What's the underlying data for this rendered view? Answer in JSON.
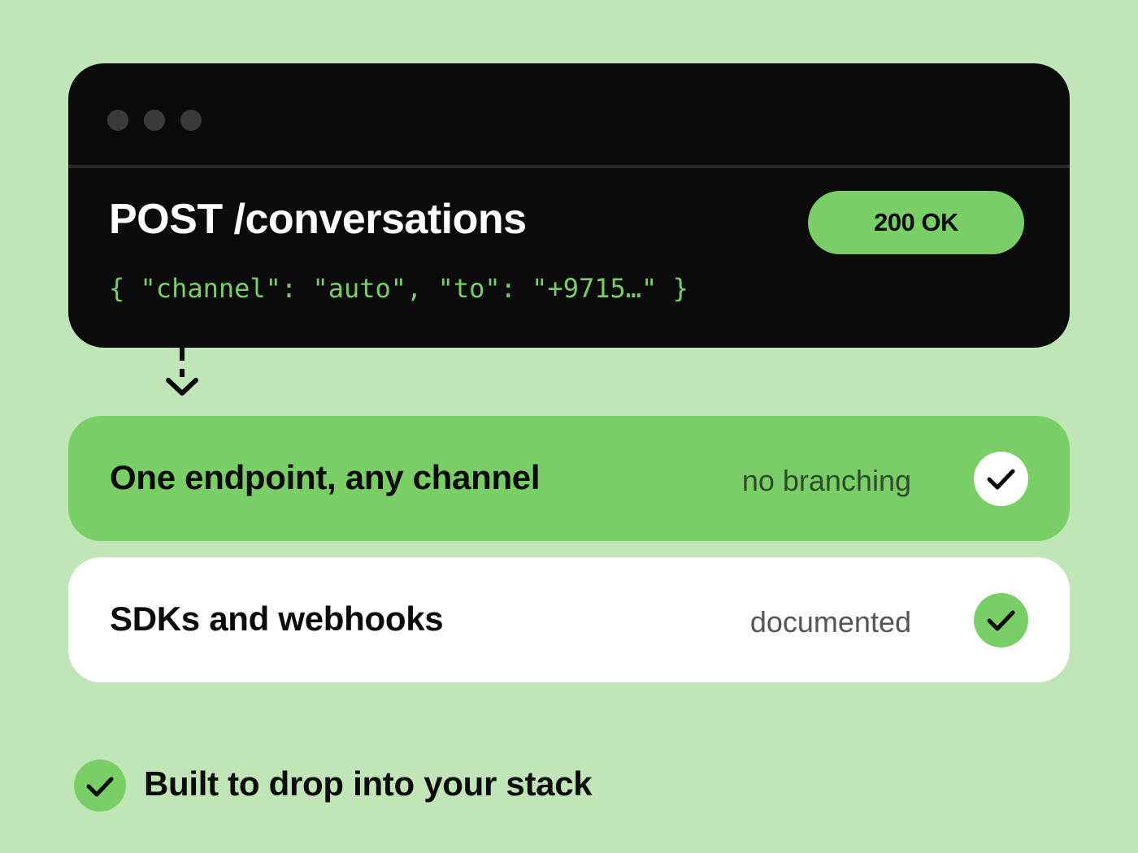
{
  "request": {
    "method_path": "POST /conversations",
    "status": "200 OK",
    "payload": "{ \"channel\": \"auto\", \"to\": \"+9715…\" }"
  },
  "features": [
    {
      "title": "One endpoint, any channel",
      "tag": "no branching",
      "icon": "check-icon"
    },
    {
      "title": "SDKs and webhooks",
      "tag": "documented",
      "icon": "check-icon"
    }
  ],
  "footer": {
    "text": "Built to drop into your stack",
    "icon": "check-icon"
  },
  "colors": {
    "background": "#c0e6b8",
    "accent_green": "#79cf66",
    "terminal": "#0b0b0b",
    "card_white": "#ffffff"
  }
}
